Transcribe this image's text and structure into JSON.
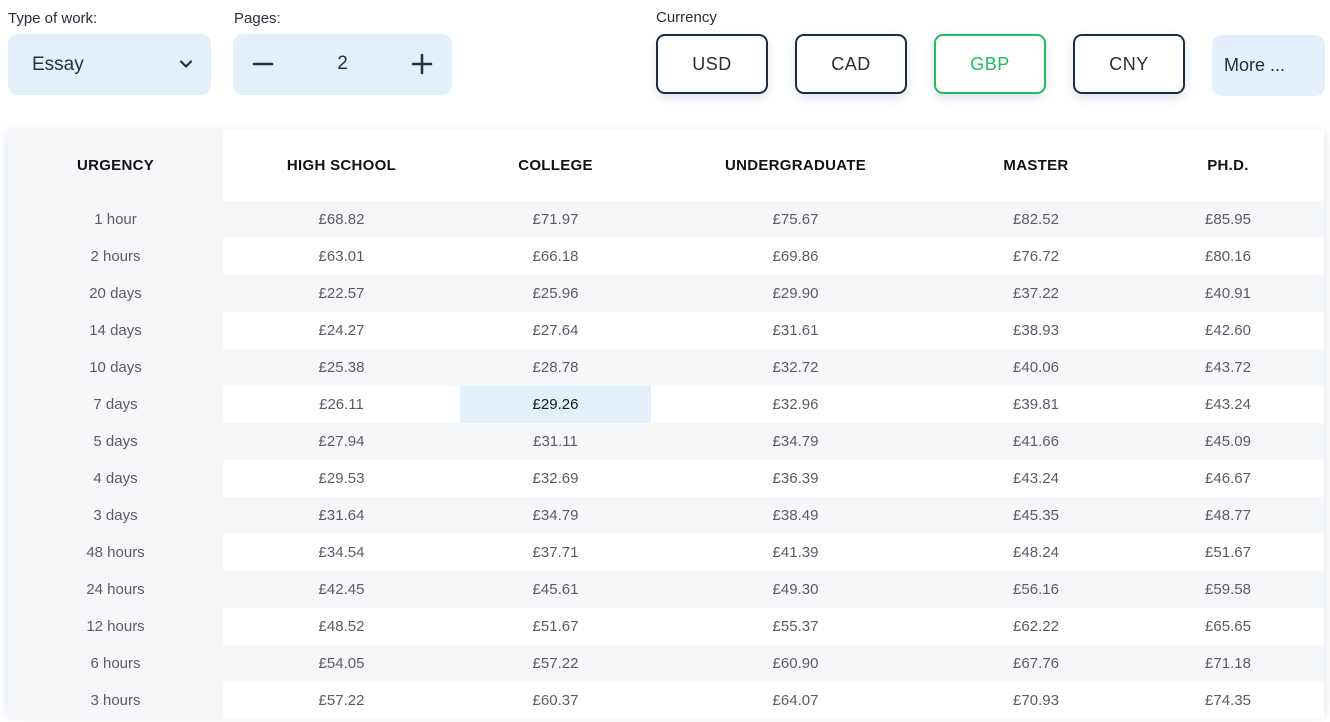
{
  "form": {
    "type_of_work": {
      "label": "Type of work:",
      "value": "Essay"
    },
    "pages": {
      "label": "Pages:",
      "value": "2"
    },
    "currency": {
      "label": "Currency",
      "options": [
        "USD",
        "CAD",
        "GBP",
        "CNY"
      ],
      "selected": "GBP",
      "more_label": "More ..."
    }
  },
  "colors": {
    "accent_active": "#1ec05c",
    "button_border": "#1f2a44",
    "light_blue": "#e3f0fc"
  },
  "table": {
    "headers": [
      "URGENCY",
      "HIGH SCHOOL",
      "COLLEGE",
      "UNDERGRADUATE",
      "MASTER",
      "PH.D."
    ],
    "selected_cell": {
      "row": "7 days",
      "column": "COLLEGE"
    },
    "rows": [
      {
        "urgency": "1 hour",
        "prices": [
          "£68.82",
          "£71.97",
          "£75.67",
          "£82.52",
          "£85.95"
        ]
      },
      {
        "urgency": "2 hours",
        "prices": [
          "£63.01",
          "£66.18",
          "£69.86",
          "£76.72",
          "£80.16"
        ]
      },
      {
        "urgency": "20 days",
        "prices": [
          "£22.57",
          "£25.96",
          "£29.90",
          "£37.22",
          "£40.91"
        ]
      },
      {
        "urgency": "14 days",
        "prices": [
          "£24.27",
          "£27.64",
          "£31.61",
          "£38.93",
          "£42.60"
        ]
      },
      {
        "urgency": "10 days",
        "prices": [
          "£25.38",
          "£28.78",
          "£32.72",
          "£40.06",
          "£43.72"
        ]
      },
      {
        "urgency": "7 days",
        "prices": [
          "£26.11",
          "£29.26",
          "£32.96",
          "£39.81",
          "£43.24"
        ]
      },
      {
        "urgency": "5 days",
        "prices": [
          "£27.94",
          "£31.11",
          "£34.79",
          "£41.66",
          "£45.09"
        ]
      },
      {
        "urgency": "4 days",
        "prices": [
          "£29.53",
          "£32.69",
          "£36.39",
          "£43.24",
          "£46.67"
        ]
      },
      {
        "urgency": "3 days",
        "prices": [
          "£31.64",
          "£34.79",
          "£38.49",
          "£45.35",
          "£48.77"
        ]
      },
      {
        "urgency": "48 hours",
        "prices": [
          "£34.54",
          "£37.71",
          "£41.39",
          "£48.24",
          "£51.67"
        ]
      },
      {
        "urgency": "24 hours",
        "prices": [
          "£42.45",
          "£45.61",
          "£49.30",
          "£56.16",
          "£59.58"
        ]
      },
      {
        "urgency": "12 hours",
        "prices": [
          "£48.52",
          "£51.67",
          "£55.37",
          "£62.22",
          "£65.65"
        ]
      },
      {
        "urgency": "6 hours",
        "prices": [
          "£54.05",
          "£57.22",
          "£60.90",
          "£67.76",
          "£71.18"
        ]
      },
      {
        "urgency": "3 hours",
        "prices": [
          "£57.22",
          "£60.37",
          "£64.07",
          "£70.93",
          "£74.35"
        ]
      }
    ]
  }
}
